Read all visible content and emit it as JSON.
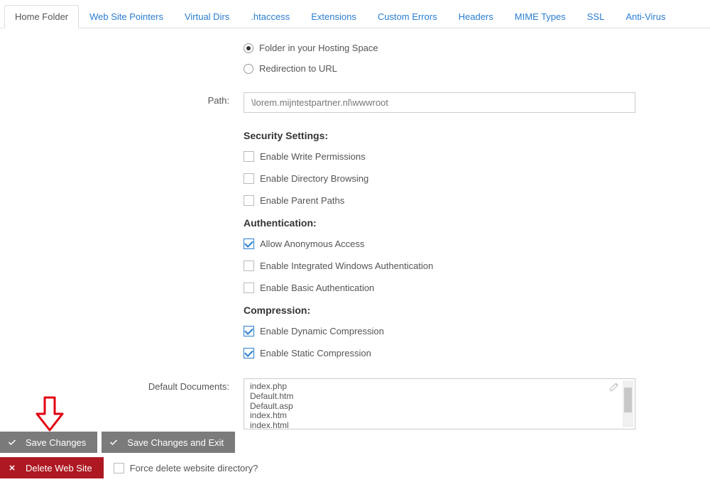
{
  "tabs": [
    {
      "label": "Home Folder",
      "active": true
    },
    {
      "label": "Web Site Pointers",
      "active": false
    },
    {
      "label": "Virtual Dirs",
      "active": false
    },
    {
      "label": ".htaccess",
      "active": false
    },
    {
      "label": "Extensions",
      "active": false
    },
    {
      "label": "Custom Errors",
      "active": false
    },
    {
      "label": "Headers",
      "active": false
    },
    {
      "label": "MIME Types",
      "active": false
    },
    {
      "label": "SSL",
      "active": false
    },
    {
      "label": "Anti-Virus",
      "active": false
    }
  ],
  "folder_type": {
    "option_folder": "Folder in your Hosting Space",
    "option_redirect": "Redirection to URL",
    "selected": "folder"
  },
  "path": {
    "label": "Path:",
    "value": "\\lorem.mijntestpartner.nl\\wwwroot"
  },
  "security": {
    "heading": "Security Settings:",
    "write_perms": {
      "label": "Enable Write Permissions",
      "checked": false
    },
    "dir_browse": {
      "label": "Enable Directory Browsing",
      "checked": false
    },
    "parent_paths": {
      "label": "Enable Parent Paths",
      "checked": false
    }
  },
  "auth": {
    "heading": "Authentication:",
    "anonymous": {
      "label": "Allow Anonymous Access",
      "checked": true
    },
    "windows": {
      "label": "Enable Integrated Windows Authentication",
      "checked": false
    },
    "basic": {
      "label": "Enable Basic Authentication",
      "checked": false
    }
  },
  "compression": {
    "heading": "Compression:",
    "dynamic": {
      "label": "Enable Dynamic Compression",
      "checked": true
    },
    "static": {
      "label": "Enable Static Compression",
      "checked": true
    }
  },
  "default_docs": {
    "label": "Default Documents:",
    "items": [
      "index.php",
      "Default.htm",
      "Default.asp",
      "index.htm",
      "index.html"
    ]
  },
  "buttons": {
    "save": "Save Changes",
    "save_exit": "Save Changes and Exit",
    "delete": "Delete Web Site",
    "force_delete": {
      "label": "Force delete website directory?",
      "checked": false
    }
  }
}
